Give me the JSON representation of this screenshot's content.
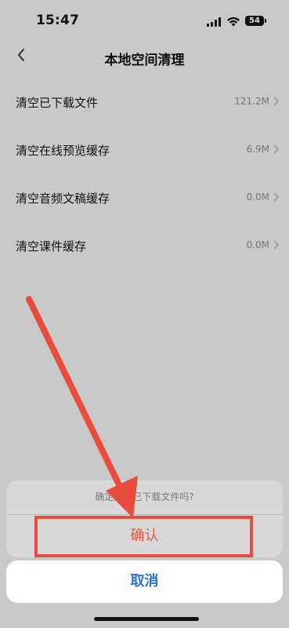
{
  "status": {
    "time": "15:47",
    "battery": "54"
  },
  "nav": {
    "title": "本地空间清理"
  },
  "rows": [
    {
      "label": "清空已下载文件",
      "value": "121.2M"
    },
    {
      "label": "清空在线预览缓存",
      "value": "6.9M"
    },
    {
      "label": "清空音频文稿缓存",
      "value": "0.0M"
    },
    {
      "label": "清空课件缓存",
      "value": "0.0M"
    }
  ],
  "dialog": {
    "message": "确定清空已下载文件吗?",
    "confirm": "确认",
    "cancel": "取消"
  },
  "colors": {
    "confirm": "#e05a4a",
    "cancel": "#2f6fdc",
    "annotation": "#e74c3c"
  }
}
